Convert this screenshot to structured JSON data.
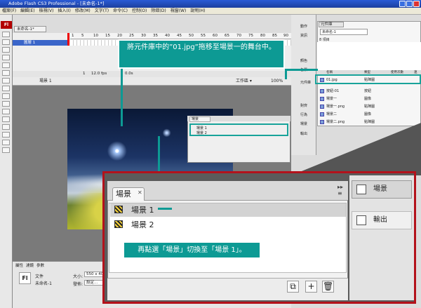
{
  "window": {
    "title": "Adobe Flash CS3 Professional - [未命名-1*]"
  },
  "menubar": [
    "檔案(F)",
    "編輯(E)",
    "檢視(V)",
    "插入(I)",
    "修改(M)",
    "文字(T)",
    "命令(C)",
    "控制(O)",
    "除錯(D)",
    "視窗(W)",
    "說明(H)"
  ],
  "document": {
    "tab": "未命名-1*",
    "layer": "圖層 1",
    "fps": "12.0 fps",
    "time": "0.0s",
    "frame": "1",
    "scene": "場景 1",
    "zoom": "100%",
    "workspace": "工作區 ▾"
  },
  "ruler": [
    "1",
    "5",
    "10",
    "15",
    "20",
    "25",
    "30",
    "35",
    "40",
    "45",
    "50",
    "55",
    "60",
    "65",
    "70",
    "75",
    "80",
    "85",
    "90"
  ],
  "properties": {
    "tabs": [
      "屬性",
      "濾鏡",
      "參數"
    ],
    "type": "文件",
    "name": "未命名-1",
    "size_label": "大小:",
    "size_value": "550 x 400",
    "publish_label": "發佈:",
    "publish_value": "設定..."
  },
  "side_buttons": [
    "動作",
    "資訊",
    "顏色",
    "色票",
    "對齊",
    "元件庫",
    "行為",
    "場景",
    "輸出"
  ],
  "library": {
    "tab": "元件庫",
    "doc": "未命名-1",
    "count": "8 項目",
    "headers": [
      "名稱",
      "類型",
      "使用次數",
      "連"
    ],
    "items": [
      {
        "name": "01.jpg",
        "type": "點陣圖"
      },
      {
        "name": "按鈕-01",
        "type": "按鈕"
      },
      {
        "name": "場景一",
        "type": "圖像"
      },
      {
        "name": "場景一.png",
        "type": "點陣圖"
      },
      {
        "name": "場景二",
        "type": "圖像"
      },
      {
        "name": "場景二.png",
        "type": "點陣圖"
      }
    ]
  },
  "mini_scene": {
    "tab": "場景",
    "rows": [
      "場景 1",
      "場景 2"
    ]
  },
  "callouts": {
    "one": "將元件庫中的”01.jpg”拖移至場景一的舞台中。",
    "two": "再點選「場景」切換至「場景 1」。"
  },
  "scene_panel": {
    "tab": "場景",
    "rows": [
      "場景 1",
      "場景 2"
    ]
  },
  "zoom_side": {
    "scene": "場景",
    "output": "輸出"
  },
  "icons": [
    "flash-logo",
    "scene-clapper-icon",
    "duplicate-scene-icon",
    "add-scene-icon",
    "delete-scene-icon",
    "panel-menu-icon",
    "close-icon"
  ]
}
